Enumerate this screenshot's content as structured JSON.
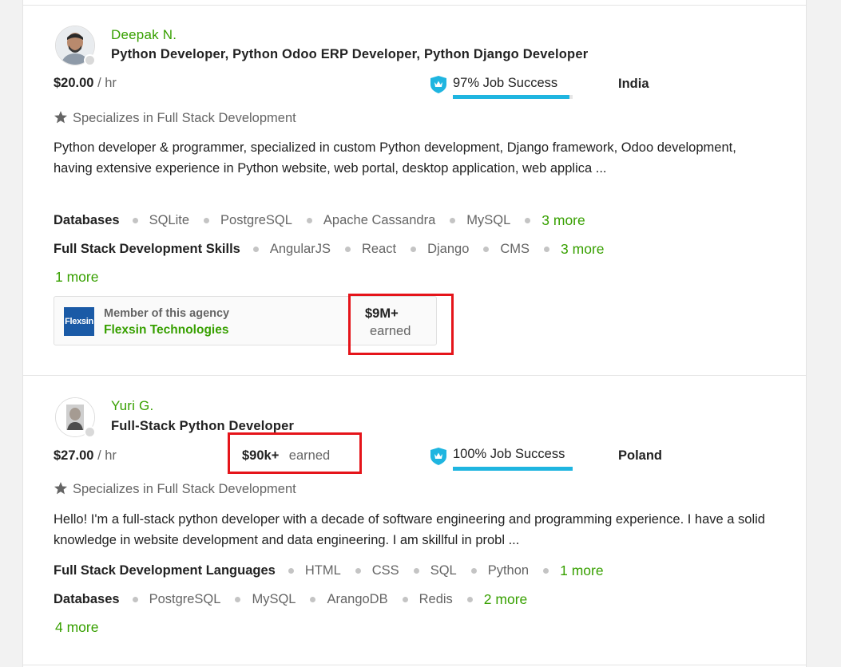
{
  "freelancers": [
    {
      "name": "Deepak N.",
      "title": "Python Developer, Python Odoo ERP Developer, Python Django Developer",
      "rate_amount": "$20.00",
      "rate_unit": "/ hr",
      "job_success": "97% Job Success",
      "job_success_value": 97,
      "country": "India",
      "specializes": "Specializes in Full Stack Development",
      "description": "Python developer & programmer, specialized in custom Python development, Django framework, Odoo development, having extensive experience in Python website, web portal, desktop application, web applica ...",
      "skill_groups": [
        {
          "label": "Databases",
          "skills": [
            "SQLite",
            "PostgreSQL",
            "Apache Cassandra",
            "MySQL"
          ],
          "more": "3 more"
        },
        {
          "label": "Full Stack Development Skills",
          "skills": [
            "AngularJS",
            "React",
            "Django",
            "CMS"
          ],
          "more": "3 more"
        }
      ],
      "extra_more": "1 more",
      "agency": {
        "member_label": "Member of this agency",
        "name": "Flexsin Technologies",
        "logo_text": "Flexsin",
        "earned_value": "$9M+",
        "earned_label": "earned"
      }
    },
    {
      "name": "Yuri G.",
      "title": "Full-Stack Python Developer",
      "rate_amount": "$27.00",
      "rate_unit": "/ hr",
      "earned_value": "$90k+",
      "earned_label": "earned",
      "job_success": "100% Job Success",
      "job_success_value": 100,
      "country": "Poland",
      "specializes": "Specializes in Full Stack Development",
      "description": "Hello! I'm a full-stack python developer with a decade of software engineering and programming experience. I have a solid knowledge in website development and data engineering. I am skillful in probl ...",
      "skill_groups": [
        {
          "label": "Full Stack Development Languages",
          "skills": [
            "HTML",
            "CSS",
            "SQL",
            "Python"
          ],
          "more": "1 more"
        },
        {
          "label": "Databases",
          "skills": [
            "PostgreSQL",
            "MySQL",
            "ArangoDB",
            "Redis"
          ],
          "more": "2 more"
        }
      ],
      "extra_more": "4 more"
    }
  ],
  "colors": {
    "accent_green": "#37a000",
    "job_success_blue": "#1fb5e0",
    "highlight_red": "#e5141a"
  },
  "icons": [
    "star-icon",
    "job-success-badge-icon",
    "online-status-dot"
  ]
}
